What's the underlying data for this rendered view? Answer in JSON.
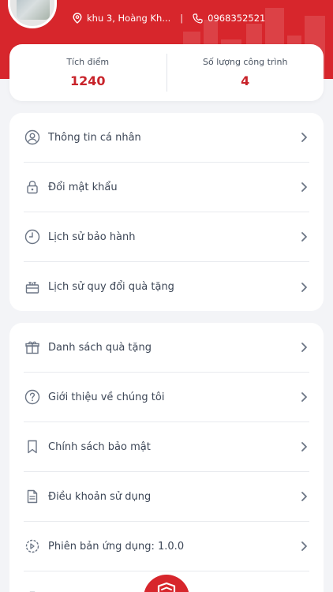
{
  "header": {
    "address": "khu 3, Hoàng Kh...",
    "separator": "|",
    "phone": "0968352521",
    "bg_color": "#d7262c"
  },
  "stats": [
    {
      "label": "Tích điểm",
      "value": "1240"
    },
    {
      "label": "Số lượng công trình",
      "value": "4"
    }
  ],
  "menu_group_1": [
    {
      "label": "Thông tin cá nhân",
      "icon": "user-circle-icon"
    },
    {
      "label": "Đổi mật khẩu",
      "icon": "lock-icon"
    },
    {
      "label": "Lịch sử bảo hành",
      "icon": "clock-icon"
    },
    {
      "label": "Lịch sử quy đổi quà tặng",
      "icon": "gift-box-icon"
    }
  ],
  "menu_group_2": [
    {
      "label": "Danh sách quà tặng",
      "icon": "gift-icon"
    },
    {
      "label": "Giới thiệu về chúng tôi",
      "icon": "question-circle-icon"
    },
    {
      "label": "Chính sách bảo mật",
      "icon": "bookmark-icon"
    },
    {
      "label": "Điều khoản sử dụng",
      "icon": "document-icon"
    },
    {
      "label": "Phiên bản ứng dụng: 1.0.0",
      "icon": "version-gear-icon"
    },
    {
      "label": "",
      "icon": "briefcase-icon"
    }
  ]
}
